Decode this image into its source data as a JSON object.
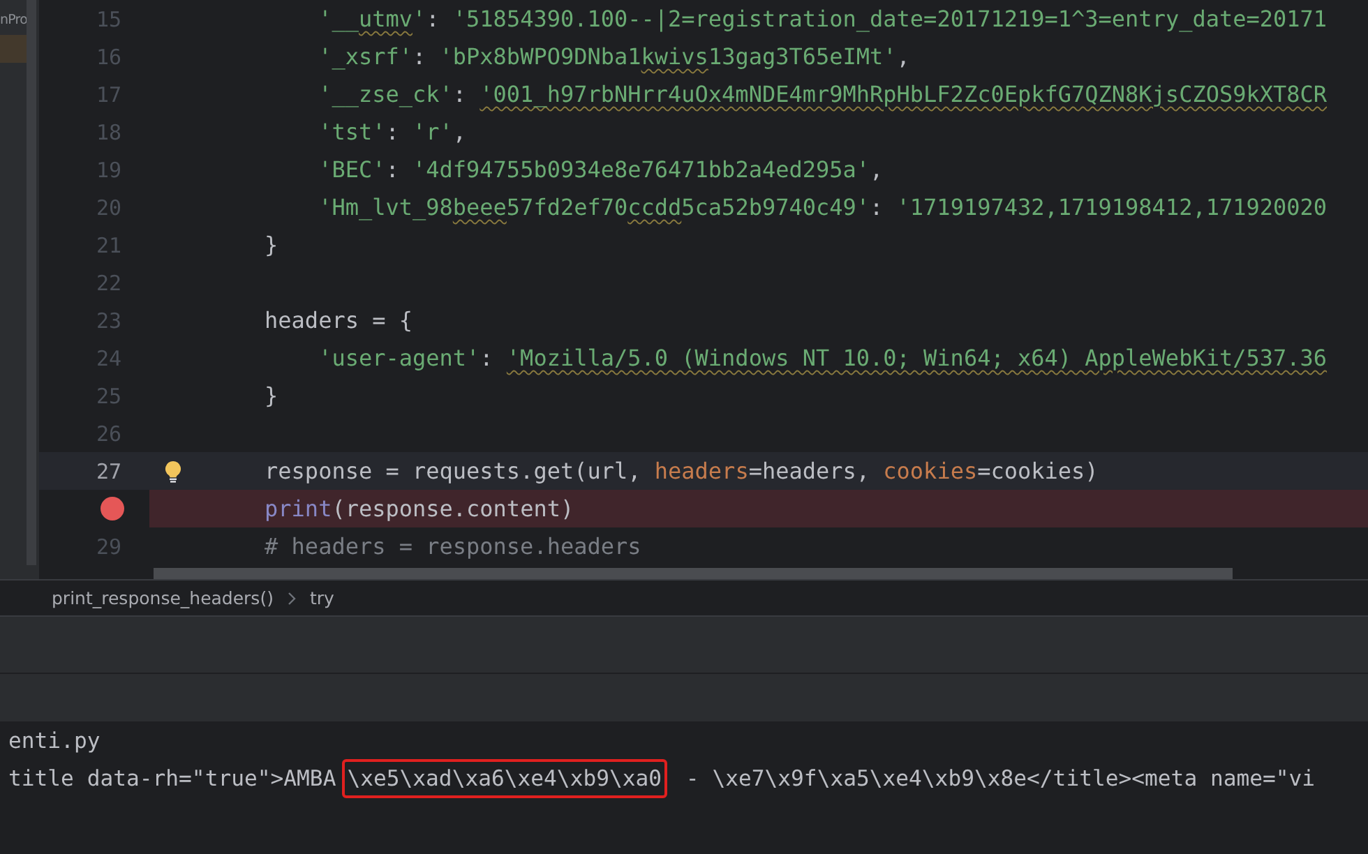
{
  "project_panel": {
    "label": "nPro"
  },
  "editor": {
    "lines": [
      {
        "number": "15",
        "current": false,
        "breakpoint": false,
        "tokens": [
          {
            "kind": "string",
            "text": "        '__"
          },
          {
            "kind": "string",
            "text": "utmv",
            "typo": true
          },
          {
            "kind": "string",
            "text": "'"
          },
          {
            "kind": "plain",
            "text": ": "
          },
          {
            "kind": "string",
            "text": "'51854390.100--|2=registration_date=20171219=1^3=entry_date=20171"
          }
        ]
      },
      {
        "number": "16",
        "current": false,
        "breakpoint": false,
        "tokens": [
          {
            "kind": "string",
            "text": "        '_xsrf'"
          },
          {
            "kind": "plain",
            "text": ": "
          },
          {
            "kind": "string",
            "text": "'bPx8bWPO9DNba1"
          },
          {
            "kind": "string",
            "text": "kwivs",
            "typo": true
          },
          {
            "kind": "string",
            "text": "13gag3T65eIMt'"
          },
          {
            "kind": "plain",
            "text": ","
          }
        ]
      },
      {
        "number": "17",
        "current": false,
        "breakpoint": false,
        "tokens": [
          {
            "kind": "string",
            "text": "        '__zse_ck'"
          },
          {
            "kind": "plain",
            "text": ": "
          },
          {
            "kind": "string",
            "text": "'001_h97rbNHrr4uOx4mNDE4mr9MhRpHbLF2Zc0EpkfG7QZN8KjsCZOS9kXT8CR",
            "typo": true
          }
        ]
      },
      {
        "number": "18",
        "current": false,
        "breakpoint": false,
        "tokens": [
          {
            "kind": "string",
            "text": "        'tst'"
          },
          {
            "kind": "plain",
            "text": ": "
          },
          {
            "kind": "string",
            "text": "'r'"
          },
          {
            "kind": "plain",
            "text": ","
          }
        ]
      },
      {
        "number": "19",
        "current": false,
        "breakpoint": false,
        "tokens": [
          {
            "kind": "string",
            "text": "        'BEC'"
          },
          {
            "kind": "plain",
            "text": ": "
          },
          {
            "kind": "string",
            "text": "'4df94755b0934e8e76471bb2a4ed295a'"
          },
          {
            "kind": "plain",
            "text": ","
          }
        ]
      },
      {
        "number": "20",
        "current": false,
        "breakpoint": false,
        "tokens": [
          {
            "kind": "string",
            "text": "        'Hm_lvt_98"
          },
          {
            "kind": "string",
            "text": "beee",
            "typo": true
          },
          {
            "kind": "string",
            "text": "57fd2ef70"
          },
          {
            "kind": "string",
            "text": "ccdd",
            "typo": true
          },
          {
            "kind": "string",
            "text": "5ca52b9740c49'"
          },
          {
            "kind": "plain",
            "text": ": "
          },
          {
            "kind": "string",
            "text": "'1719197432,1719198412,171920020"
          }
        ]
      },
      {
        "number": "21",
        "current": false,
        "breakpoint": false,
        "tokens": [
          {
            "kind": "plain",
            "text": "    }"
          }
        ]
      },
      {
        "number": "22",
        "current": false,
        "breakpoint": false
      },
      {
        "number": "23",
        "current": false,
        "breakpoint": false,
        "tokens": [
          {
            "kind": "plain",
            "text": "    headers = {"
          }
        ]
      },
      {
        "number": "24",
        "current": false,
        "breakpoint": false,
        "tokens": [
          {
            "kind": "string",
            "text": "        'user-agent'"
          },
          {
            "kind": "plain",
            "text": ": "
          },
          {
            "kind": "string",
            "text": "'Mozilla/5.0 (Windows NT 10.0; Win64; x64) AppleWebKit/537.36",
            "typo": true
          }
        ]
      },
      {
        "number": "25",
        "current": false,
        "breakpoint": false,
        "tokens": [
          {
            "kind": "plain",
            "text": "    }"
          }
        ]
      },
      {
        "number": "26",
        "current": false,
        "breakpoint": false
      },
      {
        "number": "27",
        "current": true,
        "breakpoint": false,
        "bulb": true,
        "tokens": [
          {
            "kind": "plain",
            "text": "    response = requests.get(url, "
          },
          {
            "kind": "kwarg",
            "text": "headers"
          },
          {
            "kind": "plain",
            "text": "=headers, "
          },
          {
            "kind": "kwarg",
            "text": "cookies"
          },
          {
            "kind": "plain",
            "text": "=cookies)"
          }
        ]
      },
      {
        "current": false,
        "breakpoint": true,
        "tokens": [
          {
            "kind": "builtin",
            "text": "    print"
          },
          {
            "kind": "plain",
            "text": "(response.content)"
          }
        ]
      },
      {
        "number": "29",
        "current": false,
        "breakpoint": false,
        "tokens": [
          {
            "kind": "comment",
            "text": "    # headers = response.headers"
          }
        ]
      }
    ]
  },
  "breadcrumb": [
    "print_response_headers()",
    "try"
  ],
  "console": {
    "lines": [
      {
        "segments": [
          {
            "text": "enti.py",
            "highlighted": false
          }
        ]
      },
      {
        "segments": [
          {
            "text": "title data-rh=\"true\">AMBA",
            "highlighted": false
          },
          {
            "text": "\\xe5\\xad\\xa6\\xe4\\xb9\\xa0",
            "highlighted": true
          },
          {
            "text": " - \\xe7\\x9f\\xa5\\xe4\\xb9\\x8e</title><meta name=\"vi",
            "highlighted": false
          }
        ]
      }
    ]
  }
}
